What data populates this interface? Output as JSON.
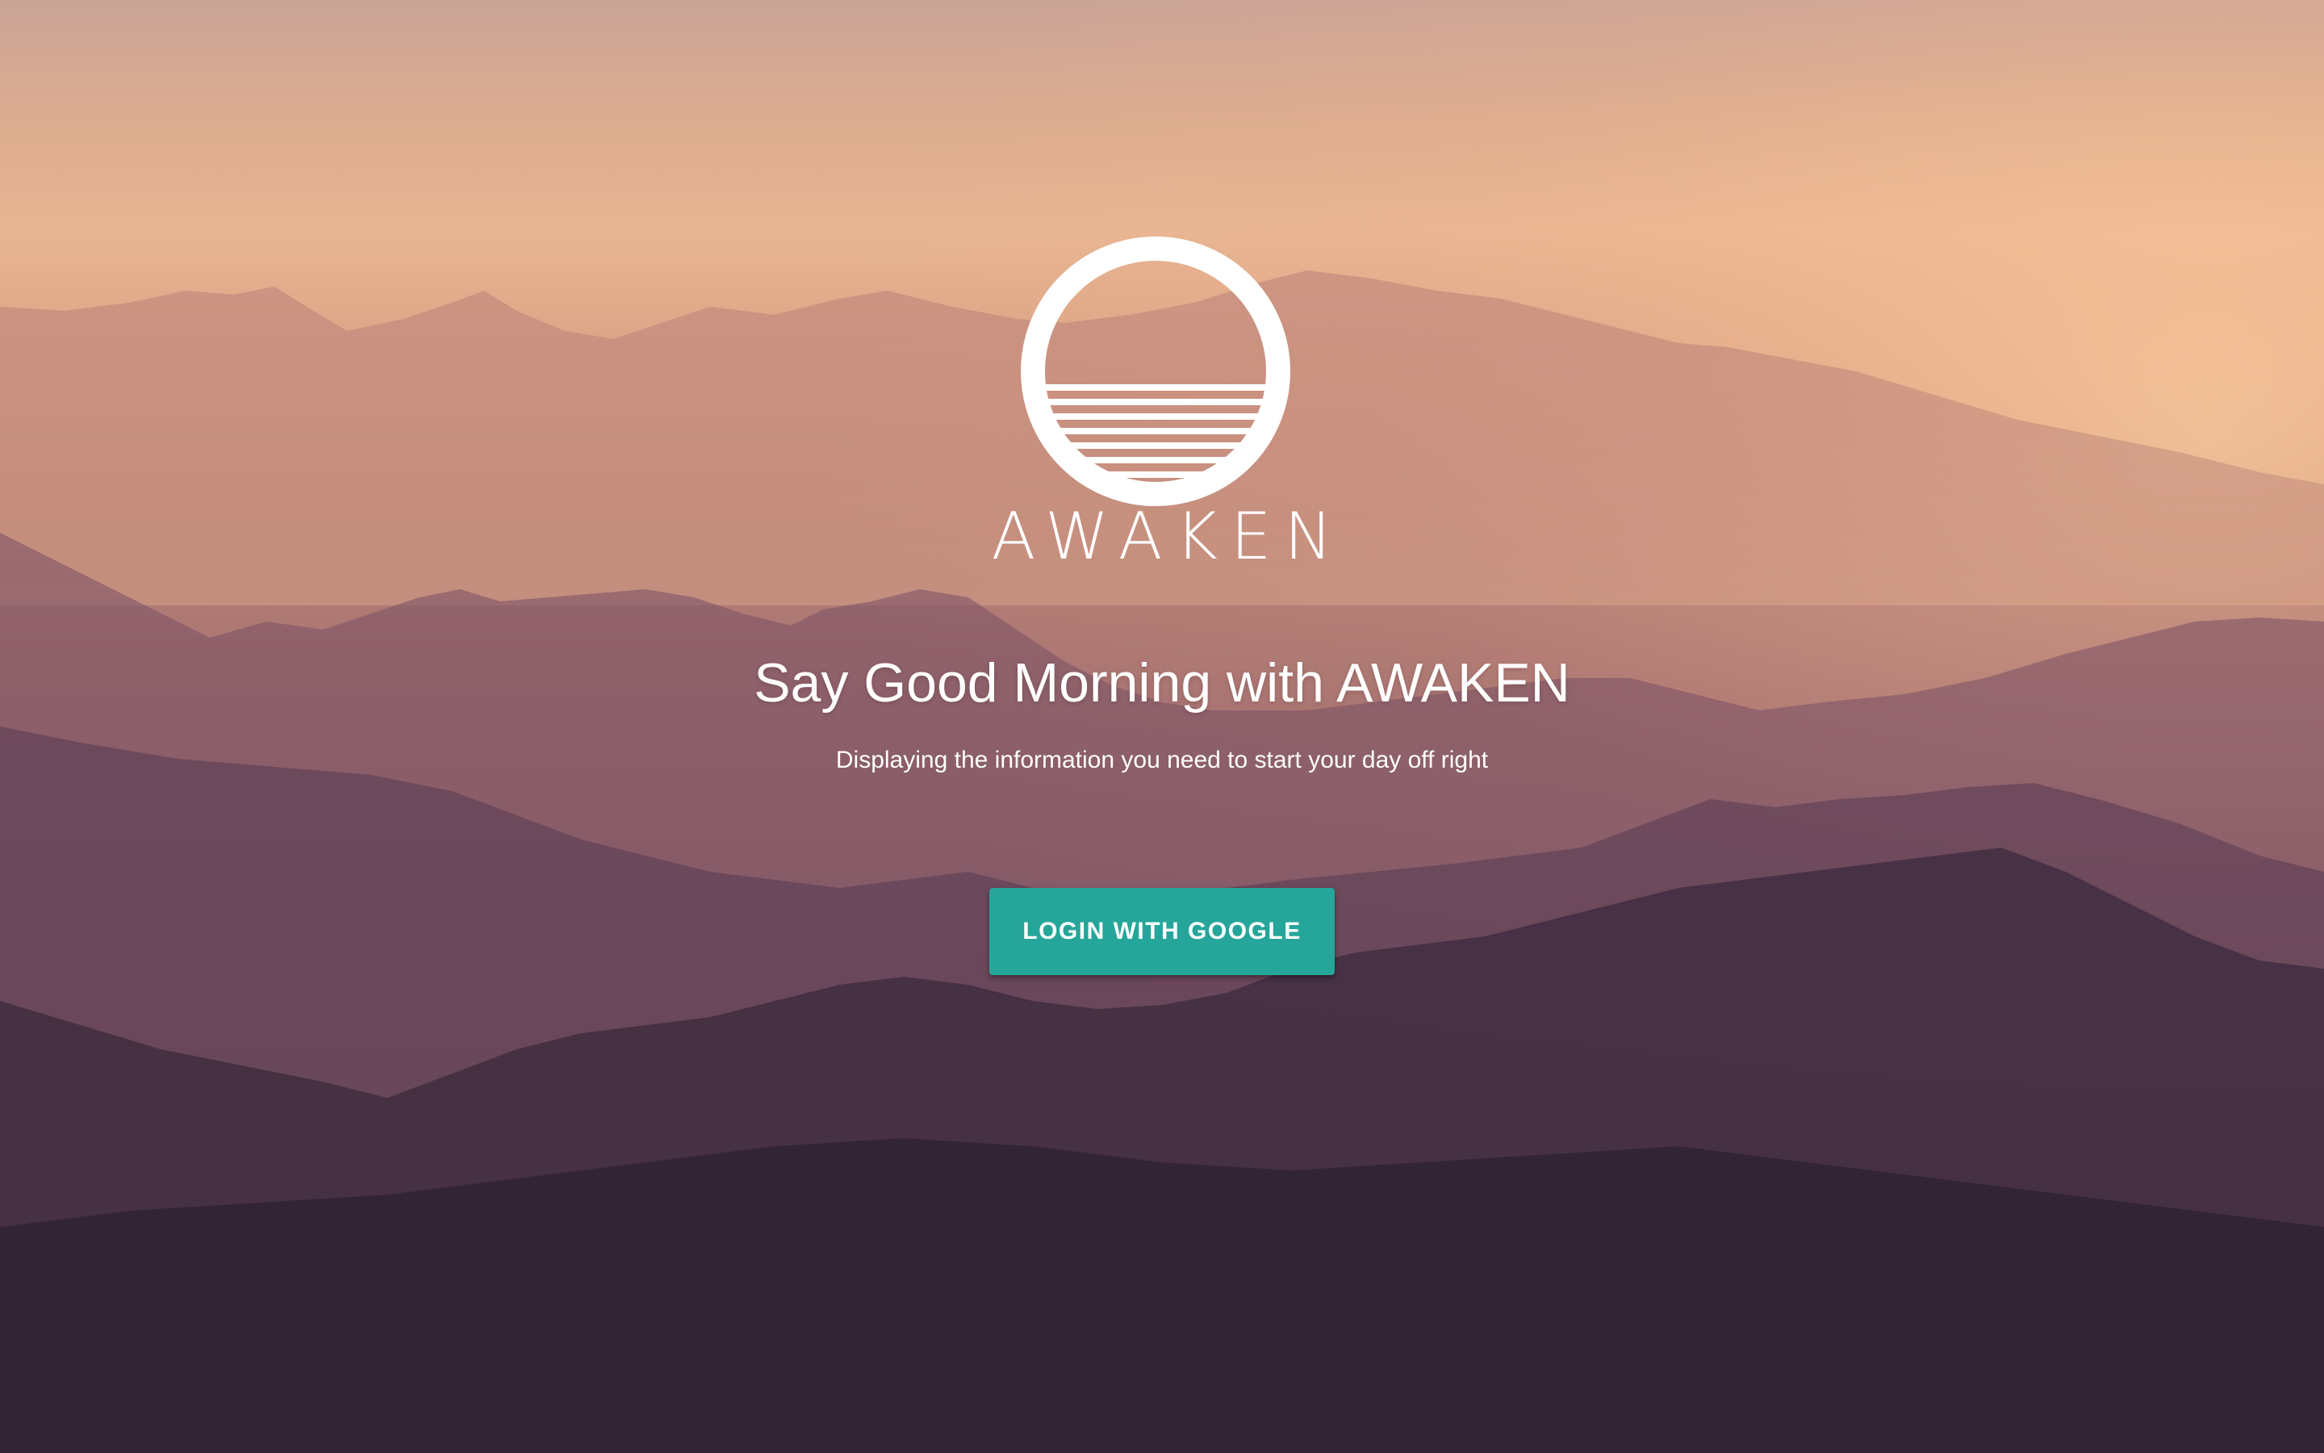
{
  "app": {
    "wordmark": "AWAKEN",
    "logo_icon": "sunset-over-water-icon"
  },
  "hero": {
    "headline": "Say Good Morning with AWAKEN",
    "subtitle": "Displaying the information you need to start your day off right"
  },
  "actions": {
    "login_label": "LOGIN WITH GOOGLE"
  },
  "colors": {
    "accent": "#26a69a",
    "text": "#ffffff",
    "sky_top": "#c9a396",
    "sky_glow": "#e8b592",
    "mountain_dark": "#2a1f2e"
  }
}
